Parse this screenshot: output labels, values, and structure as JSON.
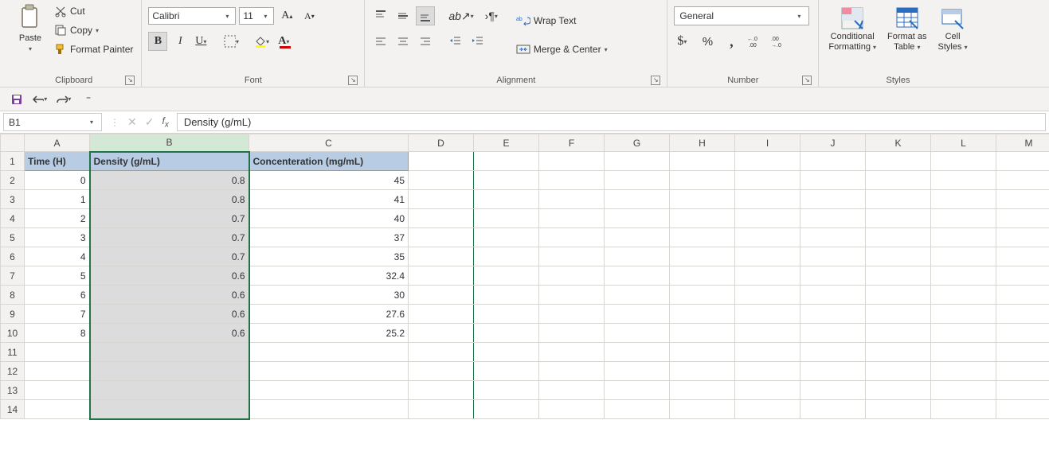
{
  "ribbon": {
    "clipboard": {
      "paste": "Paste",
      "cut": "Cut",
      "copy": "Copy",
      "format_painter": "Format Painter",
      "group_label": "Clipboard"
    },
    "font": {
      "name": "Calibri",
      "size": "11",
      "grow": "A",
      "shrink": "A",
      "bold": "B",
      "italic": "I",
      "underline": "U",
      "group_label": "Font"
    },
    "alignment": {
      "wrap_text": "Wrap Text",
      "merge_center": "Merge & Center",
      "group_label": "Alignment"
    },
    "number": {
      "format": "General",
      "currency": "$",
      "percent": "%",
      "comma": ",",
      "inc_dec": ".0",
      "group_label": "Number"
    },
    "styles": {
      "cond_fmt_l1": "Conditional",
      "cond_fmt_l2": "Formatting",
      "fmt_table_l1": "Format as",
      "fmt_table_l2": "Table",
      "cell_styles_l1": "Cell",
      "cell_styles_l2": "Styles",
      "group_label": "Styles"
    }
  },
  "namebox": "B1",
  "formula_bar": "Density (g/mL)",
  "columns": [
    "A",
    "B",
    "C",
    "D",
    "E",
    "F",
    "G",
    "H",
    "I",
    "J",
    "K",
    "L",
    "M"
  ],
  "headers": {
    "A": "Time (H)",
    "B": "Density (g/mL)",
    "C": "Concenteration (mg/mL)"
  },
  "rows": [
    {
      "A": "0",
      "B": "0.8",
      "C": "45"
    },
    {
      "A": "1",
      "B": "0.8",
      "C": "41"
    },
    {
      "A": "2",
      "B": "0.7",
      "C": "40"
    },
    {
      "A": "3",
      "B": "0.7",
      "C": "37"
    },
    {
      "A": "4",
      "B": "0.7",
      "C": "35"
    },
    {
      "A": "5",
      "B": "0.6",
      "C": "32.4"
    },
    {
      "A": "6",
      "B": "0.6",
      "C": "30"
    },
    {
      "A": "7",
      "B": "0.6",
      "C": "27.6"
    },
    {
      "A": "8",
      "B": "0.6",
      "C": "25.2"
    }
  ],
  "total_rows_visible": 14
}
